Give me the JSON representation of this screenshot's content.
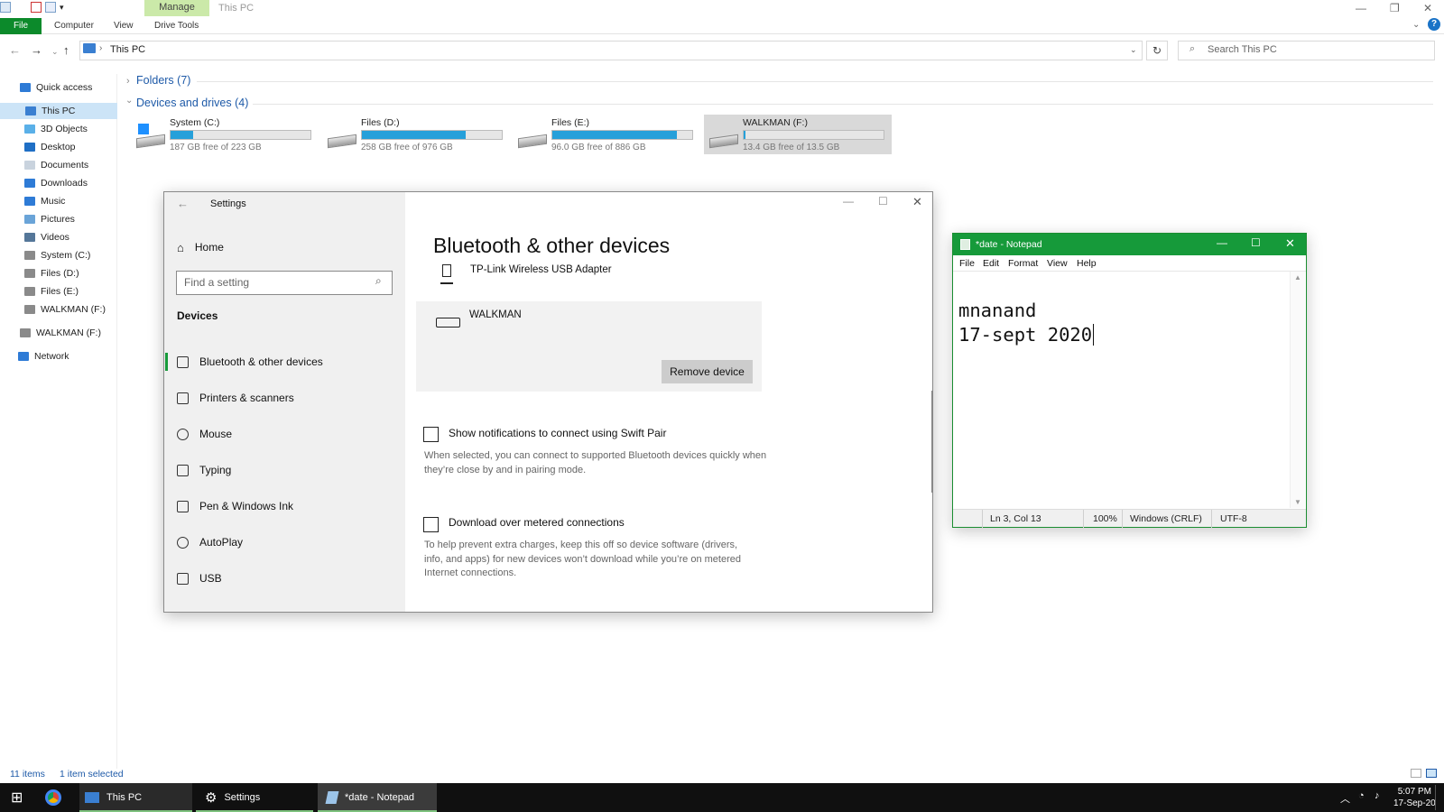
{
  "explorer": {
    "ribbon_context_tab": "Manage",
    "window_title": "This PC",
    "tabs": [
      "File",
      "Computer",
      "View",
      "Drive Tools"
    ],
    "help": "?",
    "address": "This PC",
    "search_placeholder": "Search This PC",
    "nav": [
      {
        "label": "Quick access",
        "icon": "star-icon"
      },
      {
        "label": "This PC",
        "icon": "computer-icon",
        "selected": true
      },
      {
        "label": "3D Objects",
        "icon": "cube-icon"
      },
      {
        "label": "Desktop",
        "icon": "desktop-icon"
      },
      {
        "label": "Documents",
        "icon": "document-icon"
      },
      {
        "label": "Downloads",
        "icon": "download-icon"
      },
      {
        "label": "Music",
        "icon": "music-icon"
      },
      {
        "label": "Pictures",
        "icon": "picture-icon"
      },
      {
        "label": "Videos",
        "icon": "video-icon"
      },
      {
        "label": "System (C:)",
        "icon": "drive-icon"
      },
      {
        "label": "Files (D:)",
        "icon": "drive-icon"
      },
      {
        "label": "Files (E:)",
        "icon": "drive-icon"
      },
      {
        "label": "WALKMAN (F:)",
        "icon": "drive-icon"
      },
      {
        "label": "WALKMAN (F:)",
        "icon": "drive-icon"
      },
      {
        "label": "Network",
        "icon": "network-icon"
      }
    ],
    "folders_header": "Folders (7)",
    "devices_header": "Devices and drives (4)",
    "drives": [
      {
        "name": "System (C:)",
        "free": "187 GB free of 223 GB",
        "used_fraction": 0.16
      },
      {
        "name": "Files (D:)",
        "free": "258 GB free of 976 GB",
        "used_fraction": 0.74
      },
      {
        "name": "Files (E:)",
        "free": "96.0 GB free of 886 GB",
        "used_fraction": 0.89
      },
      {
        "name": "WALKMAN (F:)",
        "free": "13.4 GB free of 13.5 GB",
        "used_fraction": 0.01,
        "selected": true
      }
    ],
    "status_items": "11 items",
    "status_selected": "1 item selected"
  },
  "settings": {
    "title": "Settings",
    "home": "Home",
    "search_placeholder": "Find a setting",
    "section": "Devices",
    "nav": [
      {
        "label": "Bluetooth & other devices",
        "icon": "bluetooth-devices-icon",
        "selected": true
      },
      {
        "label": "Printers & scanners",
        "icon": "printer-icon"
      },
      {
        "label": "Mouse",
        "icon": "mouse-icon"
      },
      {
        "label": "Typing",
        "icon": "keyboard-icon"
      },
      {
        "label": "Pen & Windows Ink",
        "icon": "pen-icon"
      },
      {
        "label": "AutoPlay",
        "icon": "autoplay-icon"
      },
      {
        "label": "USB",
        "icon": "usb-icon"
      }
    ],
    "heading": "Bluetooth & other devices",
    "device1": "TP-Link Wireless USB Adapter",
    "device2": "WALKMAN",
    "remove_button": "Remove device",
    "swift_pair_label": "Show notifications to connect using Swift Pair",
    "swift_pair_desc": "When selected, you can connect to supported Bluetooth devices quickly when they’re close by and in pairing mode.",
    "metered_label": "Download over metered connections",
    "metered_desc": "To help prevent extra charges, keep this off so device software (drivers, info, and apps) for new devices won’t download while you’re on metered Internet connections."
  },
  "notepad": {
    "title": "*date - Notepad",
    "menu": [
      "File",
      "Edit",
      "Format",
      "View",
      "Help"
    ],
    "line1": "mnanand",
    "line2": "17-sept 2020",
    "status_pos": "Ln 3, Col 13",
    "status_zoom": "100%",
    "status_eol": "Windows (CRLF)",
    "status_enc": "UTF-8"
  },
  "taskbar": {
    "items": [
      "This PC",
      "Settings",
      "*date - Notepad"
    ],
    "time": "5:07 PM",
    "date": "17-Sep-20"
  },
  "colors": {
    "accent_green": "#169a3a",
    "explorer_blue": "#1e5aa8",
    "drive_fill": "#26a0da"
  }
}
